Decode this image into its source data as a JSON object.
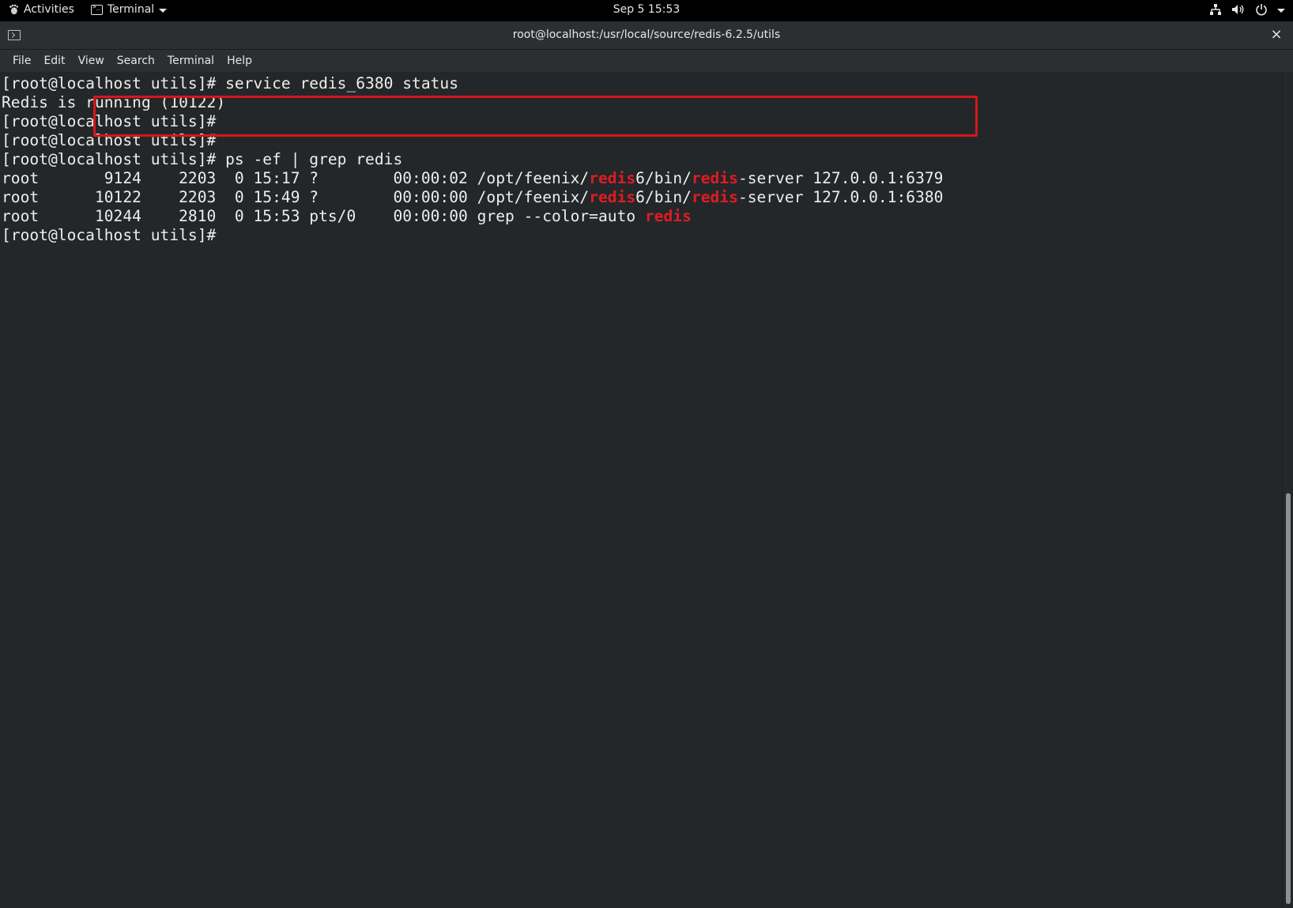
{
  "topbar": {
    "activities_label": "Activities",
    "app_menu_label": "Terminal",
    "clock": "Sep 5  15:53",
    "status_icons": [
      "network-icon",
      "volume-icon",
      "power-icon"
    ]
  },
  "window": {
    "title": "root@localhost:/usr/local/source/redis-6.2.5/utils",
    "close_glyph": "×"
  },
  "menu": {
    "items": [
      "File",
      "Edit",
      "View",
      "Search",
      "Terminal",
      "Help"
    ]
  },
  "terminal": {
    "lines": [
      {
        "segments": [
          {
            "text": "[root@localhost utils]# service redis_6380 status"
          }
        ]
      },
      {
        "segments": [
          {
            "text": "Redis is running (10122)"
          }
        ]
      },
      {
        "segments": [
          {
            "text": "[root@localhost utils]#"
          }
        ]
      },
      {
        "segments": [
          {
            "text": "[root@localhost utils]#"
          }
        ]
      },
      {
        "segments": [
          {
            "text": "[root@localhost utils]# ps -ef | grep redis"
          }
        ]
      },
      {
        "segments": [
          {
            "text": "root       9124    2203  0 15:17 ?        00:00:02 /opt/feenix/"
          },
          {
            "text": "redis",
            "hl": true
          },
          {
            "text": "6/bin/"
          },
          {
            "text": "redis",
            "hl": true
          },
          {
            "text": "-server 127.0.0.1:6379"
          }
        ]
      },
      {
        "segments": [
          {
            "text": "root      10122    2203  0 15:49 ?        00:00:00 /opt/feenix/"
          },
          {
            "text": "redis",
            "hl": true
          },
          {
            "text": "6/bin/"
          },
          {
            "text": "redis",
            "hl": true
          },
          {
            "text": "-server 127.0.0.1:6380"
          }
        ]
      },
      {
        "segments": [
          {
            "text": "root      10244    2810  0 15:53 pts/0    00:00:00 grep --color=auto "
          },
          {
            "text": "redis",
            "hl": true
          }
        ]
      },
      {
        "segments": [
          {
            "text": "[root@localhost utils]# "
          }
        ]
      }
    ],
    "highlight_color": "#e01b24",
    "annotation_box_color": "#d7161c"
  }
}
